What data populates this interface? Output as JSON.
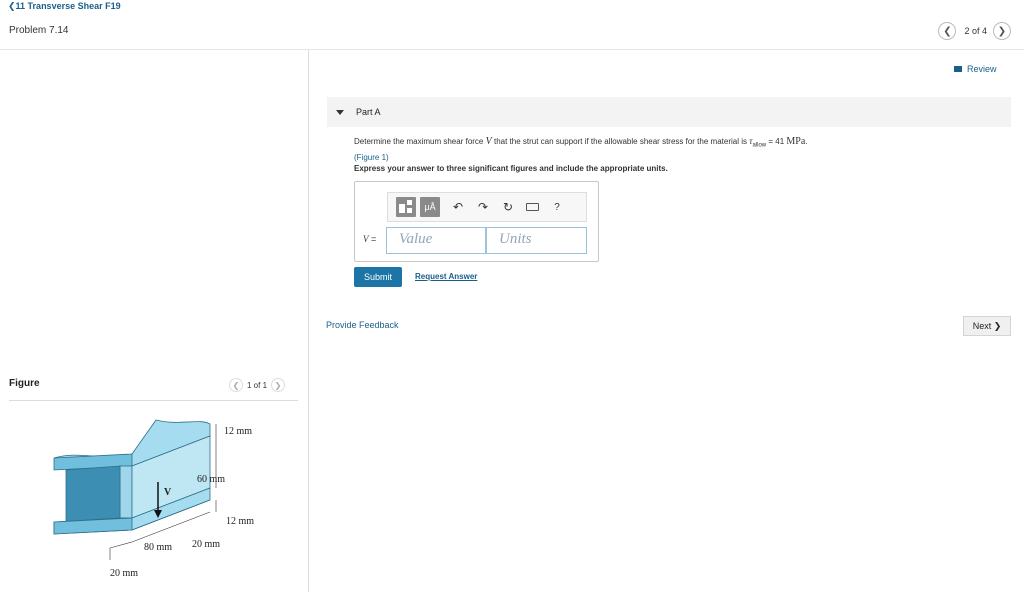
{
  "header": {
    "assignment_link": "❮11 Transverse Shear F19",
    "problem_title": "Problem 7.14",
    "pager_text": "2 of 4",
    "prev_glyph": "❮",
    "next_glyph": "❯"
  },
  "review_label": "Review",
  "part": {
    "title": "Part A",
    "question_prefix": "Determine the maximum shear force",
    "question_var": "V",
    "question_mid": "that the strut can support if the allowable shear stress for the material is",
    "tau_symbol": "τ",
    "tau_sub": "allow",
    "tau_value": " = 41 ",
    "tau_units": "MPa",
    "question_end": ".",
    "figure_link": "(Figure 1)",
    "instruction": "Express your answer to three significant figures and include the appropriate units."
  },
  "answer": {
    "var_name": "V",
    "equals": " =",
    "value_placeholder": "Value",
    "units_placeholder": "Units",
    "toolbar": {
      "mu_label": "μÅ",
      "undo_glyph": "↶",
      "redo_glyph": "↷",
      "reset_glyph": "↻",
      "help_glyph": "?"
    }
  },
  "buttons": {
    "submit": "Submit",
    "request_answer": "Request Answer",
    "provide_feedback": "Provide Feedback",
    "next": "Next ❯"
  },
  "figure": {
    "title": "Figure",
    "pager_text": "1 of 1",
    "prev_glyph": "❮",
    "next_glyph": "❯",
    "dims": {
      "top_flange": "12 mm",
      "web_height": "60 mm",
      "bottom_flange": "12 mm",
      "width_left": "80 mm",
      "width_right": "20 mm",
      "bottom_width": "20 mm",
      "force": "V"
    }
  },
  "colors": {
    "link": "#1a5f8a",
    "submit_bg": "#1d74a6",
    "beam_fill": "#8fd0ea",
    "beam_dark": "#3c8fb3"
  }
}
